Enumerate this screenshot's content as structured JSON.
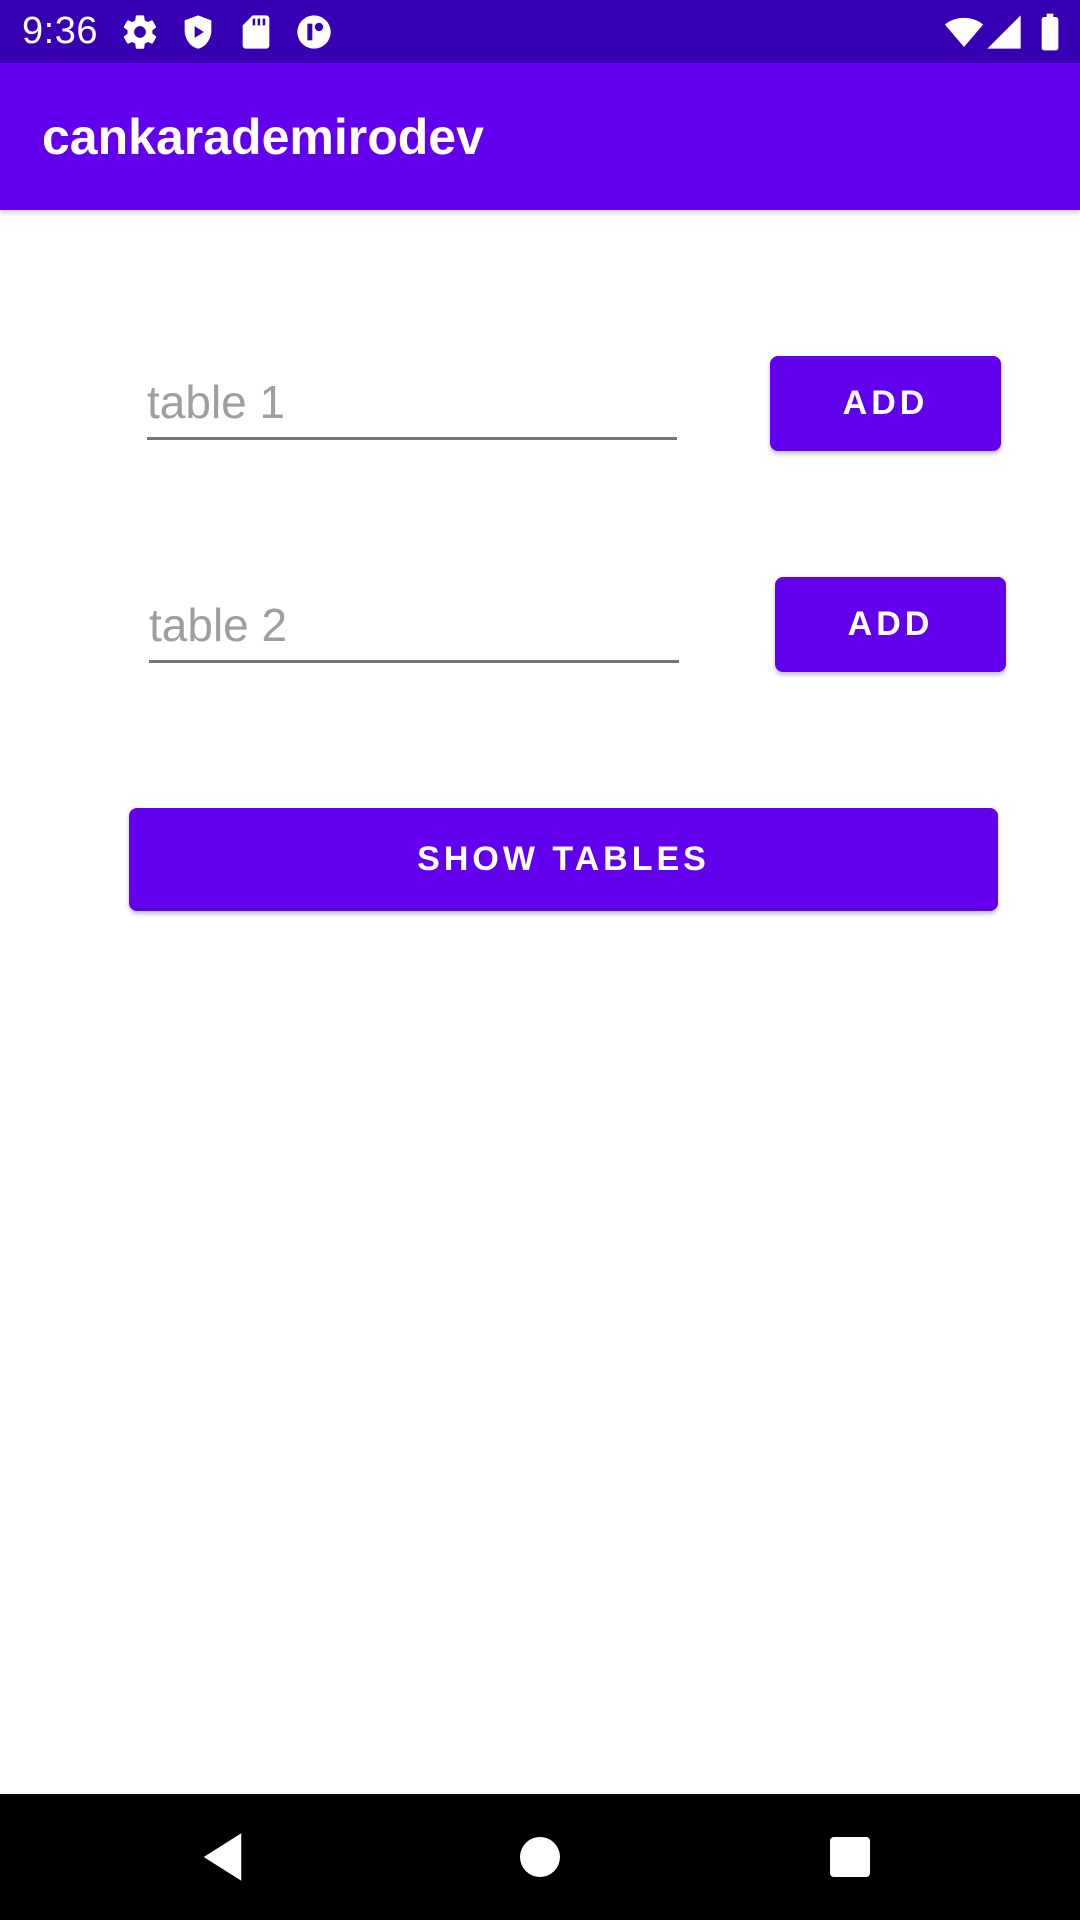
{
  "status_bar": {
    "time": "9:36",
    "left_icons": [
      "gear-icon",
      "shield-play-icon",
      "sd-card-icon",
      "circle-app-icon"
    ],
    "right_icons": [
      "wifi-icon",
      "cell-signal-icon",
      "battery-icon"
    ]
  },
  "app_bar": {
    "title": "cankarademirodev"
  },
  "form": {
    "row1": {
      "placeholder": "table 1",
      "value": "",
      "button_label": "ADD"
    },
    "row2": {
      "placeholder": "table 2",
      "value": "",
      "button_label": "ADD"
    },
    "show_tables_label": "SHOW TABLES"
  },
  "nav_bar": {
    "buttons": [
      "back-icon",
      "home-icon",
      "recents-icon"
    ]
  },
  "colors": {
    "status_bar": "#3700B3",
    "primary": "#6200EE",
    "underline": "#757575",
    "placeholder": "#9E9E9E"
  }
}
